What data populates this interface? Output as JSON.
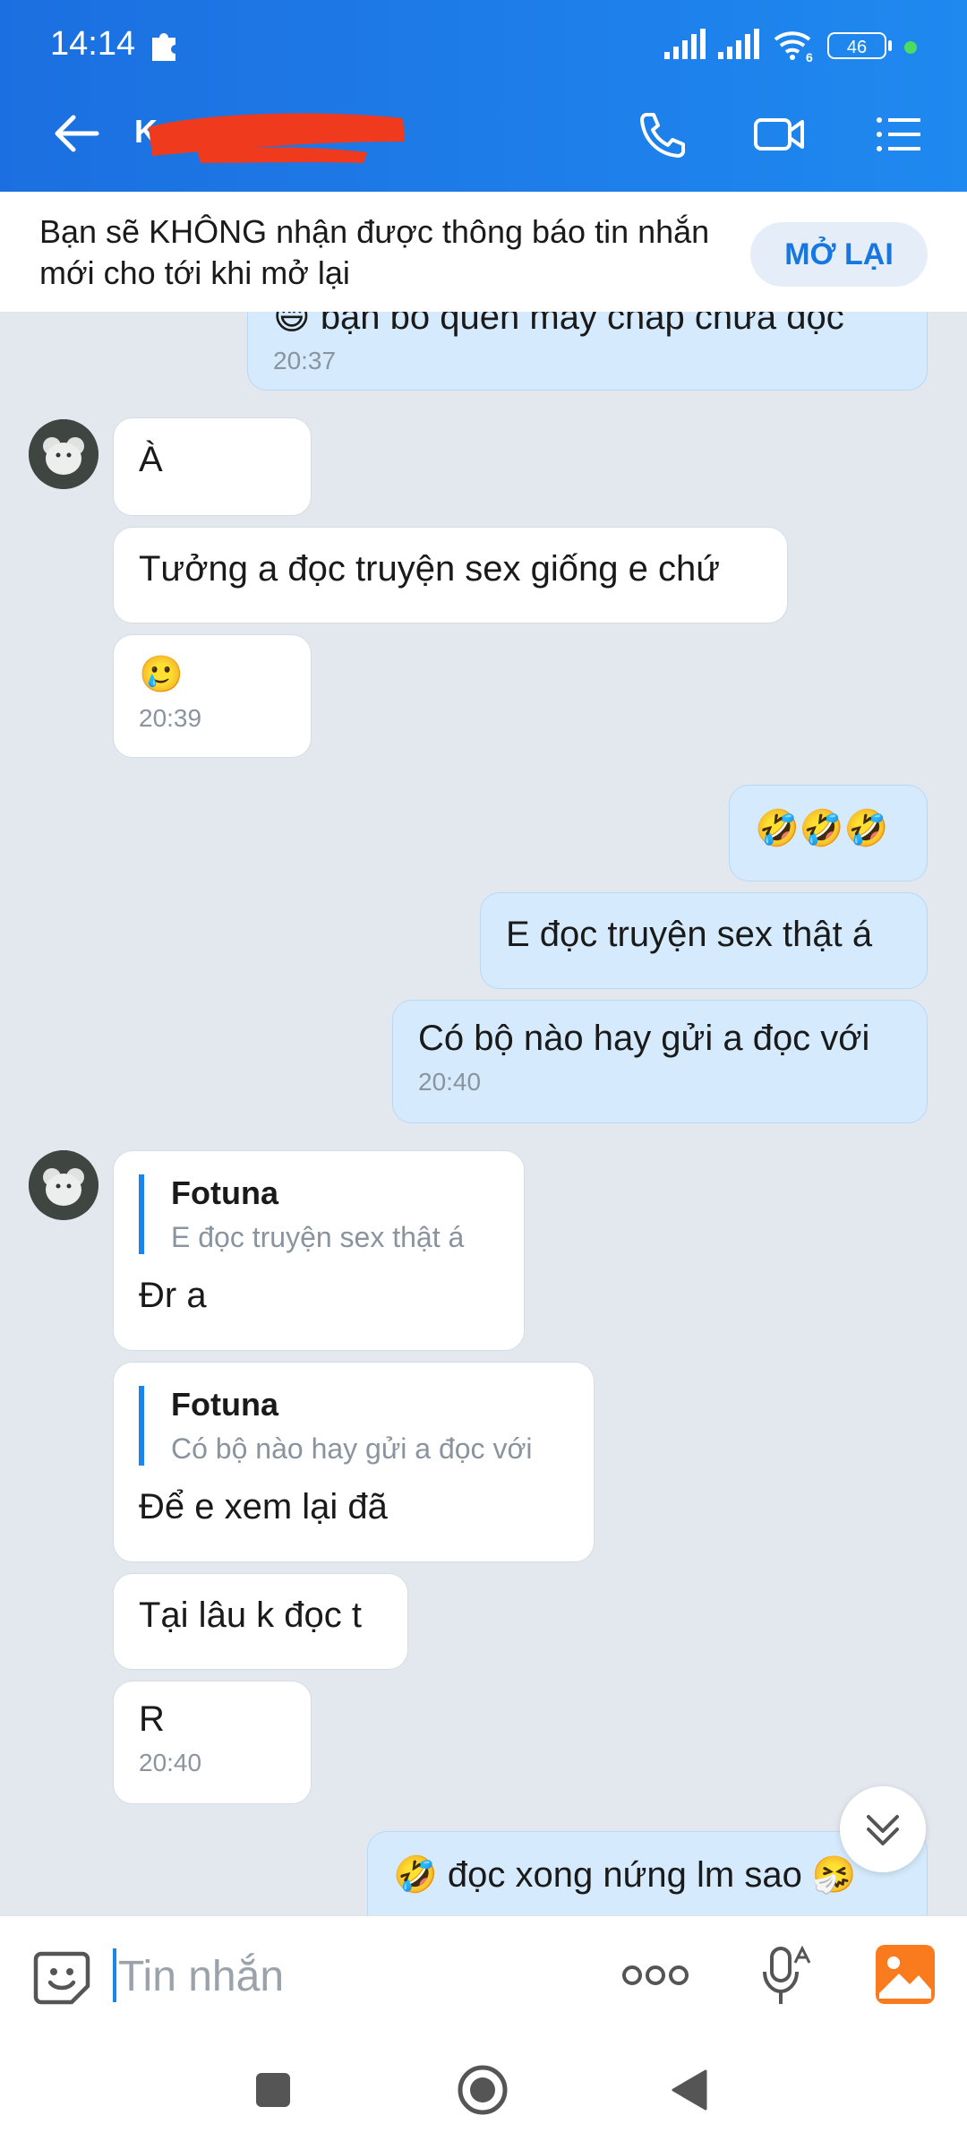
{
  "status_bar": {
    "time": "14:14",
    "battery": "46",
    "network": "6"
  },
  "header": {
    "chat_name": "K"
  },
  "notice": {
    "text": "Bạn sẽ KHÔNG nhận được thông báo tin nhắn mới cho tới khi mở lại",
    "button": "MỞ LẠI"
  },
  "messages": [
    {
      "dir": "out",
      "text": "😄 bạn bỏ quên mấy chap chưa đọc",
      "time": "20:37"
    },
    {
      "dir": "in",
      "text": "À"
    },
    {
      "dir": "in",
      "text": "Tưởng a đọc truyện sex giống e chứ"
    },
    {
      "dir": "in",
      "text": "🥲",
      "time": "20:39"
    },
    {
      "dir": "out",
      "text": "🤣🤣🤣"
    },
    {
      "dir": "out",
      "text": "E đọc truyện sex thật á"
    },
    {
      "dir": "out",
      "text": "Có bộ nào hay gửi a đọc với",
      "time": "20:40"
    },
    {
      "dir": "in",
      "quote_name": "Fotuna",
      "quote_text": "E đọc truyện sex thật á",
      "text": "Đr a"
    },
    {
      "dir": "in",
      "quote_name": "Fotuna",
      "quote_text": "Có bộ nào hay gửi a đọc với",
      "text": "Để e xem lại đã"
    },
    {
      "dir": "in",
      "text": "Tại lâu k đọc t"
    },
    {
      "dir": "in",
      "text": "R",
      "time": "20:40"
    },
    {
      "dir": "out",
      "text": "🤣 đọc xong nứng lm sao 🤧"
    }
  ],
  "input": {
    "placeholder": "Tin nhắn"
  },
  "colors": {
    "header": "#1f89f0",
    "incoming_bubble": "#ffffff",
    "outgoing_bubble": "#d5ebfd",
    "chat_background": "#e3e8ef",
    "accent": "#1a86ea"
  },
  "icons": [
    "back-arrow-icon",
    "phone-icon",
    "video-call-icon",
    "menu-list-icon",
    "chevron-down-icon",
    "sticker-icon",
    "more-dots-icon",
    "voice-text-icon",
    "gallery-icon",
    "nav-recents-icon",
    "nav-home-icon",
    "nav-back-icon"
  ]
}
